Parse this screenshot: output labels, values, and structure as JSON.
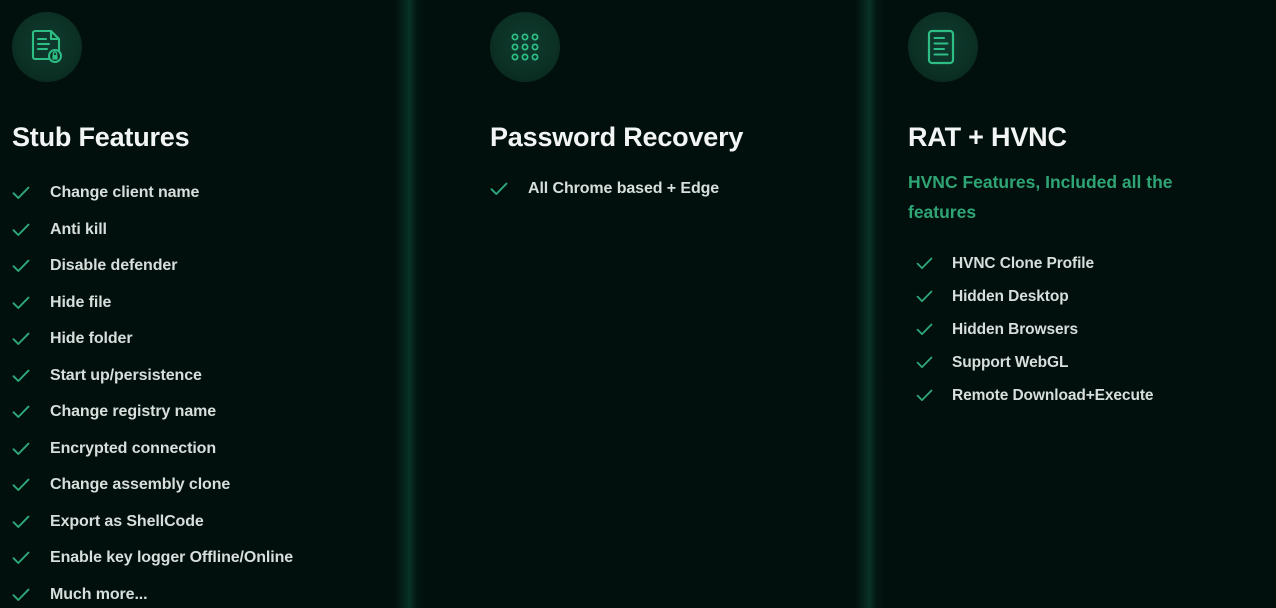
{
  "background_color": "#01100d",
  "accent_green": "#2fa576",
  "check_color": "#2fa87a",
  "title_color": "#f2f5f4",
  "label_color": "#d7dedb",
  "columns": [
    {
      "icon_name": "document-lock-icon",
      "title": "Stub Features",
      "subtitle": "",
      "features": [
        "Change client name",
        "Anti kill",
        "Disable defender",
        "Hide file",
        "Hide folder",
        "Start up/persistence",
        "Change registry name",
        "Encrypted connection",
        "Change assembly clone",
        "Export as ShellCode",
        "Enable key logger Offline/Online",
        "Much more..."
      ]
    },
    {
      "icon_name": "keypad-dots-icon",
      "title": "Password Recovery",
      "subtitle": "",
      "features": [
        "All Chrome based + Edge"
      ]
    },
    {
      "icon_name": "document-lines-icon",
      "title": "RAT + HVNC",
      "subtitle": "HVNC Features, Included all the features",
      "features": [
        "HVNC Clone Profile",
        "Hidden Desktop",
        "Hidden Browsers",
        "Support WebGL",
        "Remote Download+Execute"
      ]
    }
  ]
}
